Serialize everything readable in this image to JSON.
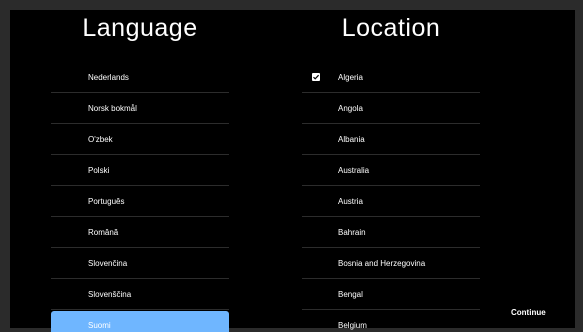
{
  "language": {
    "title": "Language",
    "items": [
      {
        "label": "Nederlands"
      },
      {
        "label": "Norsk bokmål"
      },
      {
        "label": "O'zbek"
      },
      {
        "label": "Polski"
      },
      {
        "label": "Português"
      },
      {
        "label": "Română"
      },
      {
        "label": "Slovenčina"
      },
      {
        "label": "Slovenščina"
      },
      {
        "label": "Suomi",
        "selected": true
      }
    ]
  },
  "location": {
    "title": "Location",
    "items": [
      {
        "label": "Algeria",
        "checked": true
      },
      {
        "label": "Angola"
      },
      {
        "label": "Albania"
      },
      {
        "label": "Australia"
      },
      {
        "label": "Austria"
      },
      {
        "label": "Bahrain"
      },
      {
        "label": "Bosnia and Herzegovina"
      },
      {
        "label": "Bengal"
      },
      {
        "label": "Belgium"
      }
    ]
  },
  "actions": {
    "continue_label": "Continue"
  },
  "colors": {
    "selected_bg": "#6fb6ff",
    "background": "#000000",
    "frame": "#2b2b2b",
    "divider": "#2c2c2c"
  },
  "icons": {
    "checkbox_checked": "checkmark-icon"
  }
}
